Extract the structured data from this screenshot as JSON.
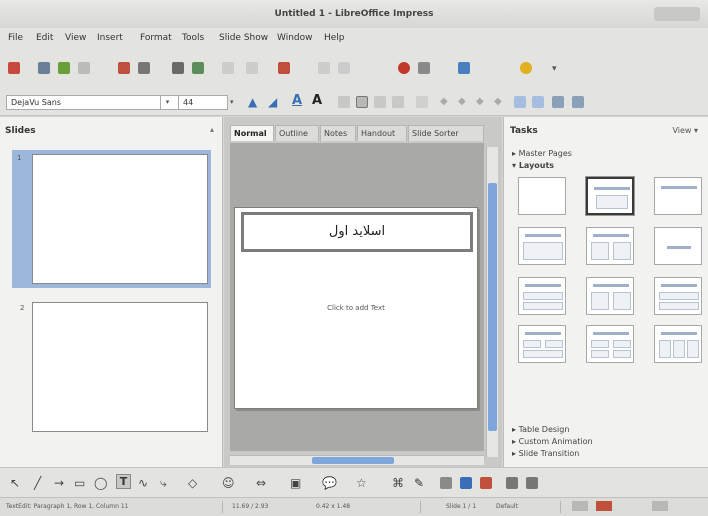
{
  "window": {
    "title": "Untitled 1 - LibreOffice Impress"
  },
  "menu": [
    "File",
    "Edit",
    "View",
    "Insert",
    "Format",
    "Tools",
    "Slide Show",
    "Window",
    "Help"
  ],
  "format_toolbar": {
    "font_name": "DejaVu Sans",
    "font_size": "44"
  },
  "slides_pane": {
    "title": "Slides",
    "slides": [
      {
        "number": "1",
        "selected": true
      },
      {
        "number": "2",
        "selected": false
      }
    ]
  },
  "editor": {
    "tabs": [
      "Normal",
      "Outline",
      "Notes",
      "Handout",
      "Slide Sorter"
    ],
    "active_tab": "Normal",
    "slide_title": "اسلاید اول",
    "content_placeholder": "Click to add Text"
  },
  "tasks_pane": {
    "title": "Tasks",
    "view_label": "View",
    "sections_top": [
      "Master Pages",
      "Layouts"
    ],
    "sections_bottom": [
      "Table Design",
      "Custom Animation",
      "Slide Transition"
    ],
    "layout_count": 12,
    "selected_layout_index": 1
  },
  "status_bar": {
    "position": "TextEdit: Paragraph 1, Row 1, Column 11",
    "coords": "11.69 / 2.93",
    "size": "0.42 x 1.48",
    "slide": "Slide 1 / 1",
    "master": "Default"
  }
}
